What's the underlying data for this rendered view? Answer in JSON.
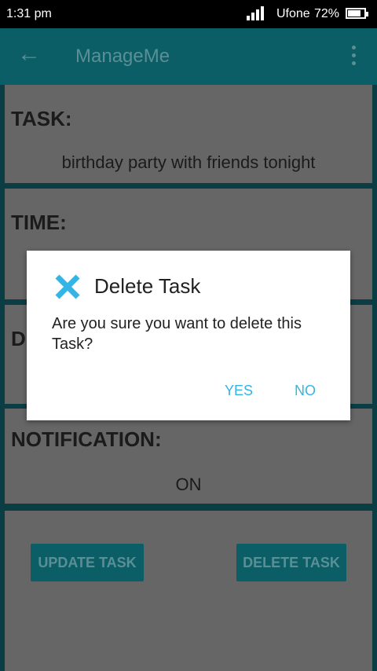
{
  "status_bar": {
    "time": "1:31 pm",
    "carrier": "Ufone",
    "battery": "72%"
  },
  "app_bar": {
    "title": "ManageMe",
    "back_icon": "arrow-left-icon",
    "menu_icon": "overflow-menu-icon"
  },
  "cards": {
    "task": {
      "label": "TASK:",
      "value": "birthday party with friends tonight"
    },
    "time": {
      "label": "TIME:"
    },
    "date": {
      "label": "D"
    },
    "notification": {
      "label": "NOTIFICATION:",
      "value": "ON"
    }
  },
  "actions": {
    "update": "UPDATE TASK",
    "delete": "DELETE TASK"
  },
  "dialog": {
    "title": "Delete Task",
    "message": "Are you sure you want to delete this Task?",
    "yes": "YES",
    "no": "NO",
    "icon": "close-x-icon",
    "icon_color": "#33b5e5"
  },
  "colors": {
    "app_bar": "#0b5d66",
    "card": "#666666",
    "accent": "#33b5e5"
  }
}
